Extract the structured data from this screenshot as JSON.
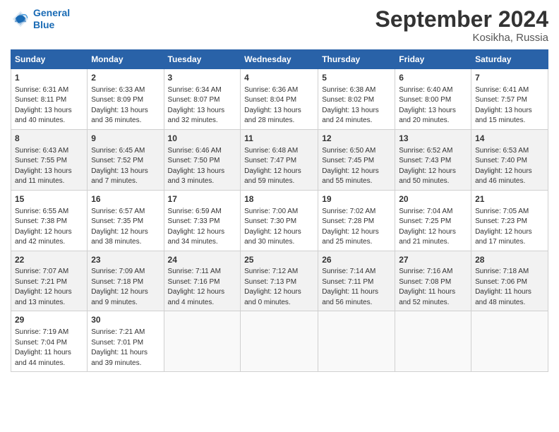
{
  "header": {
    "logo_line1": "General",
    "logo_line2": "Blue",
    "month": "September 2024",
    "location": "Kosikha, Russia"
  },
  "days_of_week": [
    "Sunday",
    "Monday",
    "Tuesday",
    "Wednesday",
    "Thursday",
    "Friday",
    "Saturday"
  ],
  "weeks": [
    [
      {
        "day": 1,
        "info": "Sunrise: 6:31 AM\nSunset: 8:11 PM\nDaylight: 13 hours\nand 40 minutes."
      },
      {
        "day": 2,
        "info": "Sunrise: 6:33 AM\nSunset: 8:09 PM\nDaylight: 13 hours\nand 36 minutes."
      },
      {
        "day": 3,
        "info": "Sunrise: 6:34 AM\nSunset: 8:07 PM\nDaylight: 13 hours\nand 32 minutes."
      },
      {
        "day": 4,
        "info": "Sunrise: 6:36 AM\nSunset: 8:04 PM\nDaylight: 13 hours\nand 28 minutes."
      },
      {
        "day": 5,
        "info": "Sunrise: 6:38 AM\nSunset: 8:02 PM\nDaylight: 13 hours\nand 24 minutes."
      },
      {
        "day": 6,
        "info": "Sunrise: 6:40 AM\nSunset: 8:00 PM\nDaylight: 13 hours\nand 20 minutes."
      },
      {
        "day": 7,
        "info": "Sunrise: 6:41 AM\nSunset: 7:57 PM\nDaylight: 13 hours\nand 15 minutes."
      }
    ],
    [
      {
        "day": 8,
        "info": "Sunrise: 6:43 AM\nSunset: 7:55 PM\nDaylight: 13 hours\nand 11 minutes."
      },
      {
        "day": 9,
        "info": "Sunrise: 6:45 AM\nSunset: 7:52 PM\nDaylight: 13 hours\nand 7 minutes."
      },
      {
        "day": 10,
        "info": "Sunrise: 6:46 AM\nSunset: 7:50 PM\nDaylight: 13 hours\nand 3 minutes."
      },
      {
        "day": 11,
        "info": "Sunrise: 6:48 AM\nSunset: 7:47 PM\nDaylight: 12 hours\nand 59 minutes."
      },
      {
        "day": 12,
        "info": "Sunrise: 6:50 AM\nSunset: 7:45 PM\nDaylight: 12 hours\nand 55 minutes."
      },
      {
        "day": 13,
        "info": "Sunrise: 6:52 AM\nSunset: 7:43 PM\nDaylight: 12 hours\nand 50 minutes."
      },
      {
        "day": 14,
        "info": "Sunrise: 6:53 AM\nSunset: 7:40 PM\nDaylight: 12 hours\nand 46 minutes."
      }
    ],
    [
      {
        "day": 15,
        "info": "Sunrise: 6:55 AM\nSunset: 7:38 PM\nDaylight: 12 hours\nand 42 minutes."
      },
      {
        "day": 16,
        "info": "Sunrise: 6:57 AM\nSunset: 7:35 PM\nDaylight: 12 hours\nand 38 minutes."
      },
      {
        "day": 17,
        "info": "Sunrise: 6:59 AM\nSunset: 7:33 PM\nDaylight: 12 hours\nand 34 minutes."
      },
      {
        "day": 18,
        "info": "Sunrise: 7:00 AM\nSunset: 7:30 PM\nDaylight: 12 hours\nand 30 minutes."
      },
      {
        "day": 19,
        "info": "Sunrise: 7:02 AM\nSunset: 7:28 PM\nDaylight: 12 hours\nand 25 minutes."
      },
      {
        "day": 20,
        "info": "Sunrise: 7:04 AM\nSunset: 7:25 PM\nDaylight: 12 hours\nand 21 minutes."
      },
      {
        "day": 21,
        "info": "Sunrise: 7:05 AM\nSunset: 7:23 PM\nDaylight: 12 hours\nand 17 minutes."
      }
    ],
    [
      {
        "day": 22,
        "info": "Sunrise: 7:07 AM\nSunset: 7:21 PM\nDaylight: 12 hours\nand 13 minutes."
      },
      {
        "day": 23,
        "info": "Sunrise: 7:09 AM\nSunset: 7:18 PM\nDaylight: 12 hours\nand 9 minutes."
      },
      {
        "day": 24,
        "info": "Sunrise: 7:11 AM\nSunset: 7:16 PM\nDaylight: 12 hours\nand 4 minutes."
      },
      {
        "day": 25,
        "info": "Sunrise: 7:12 AM\nSunset: 7:13 PM\nDaylight: 12 hours\nand 0 minutes."
      },
      {
        "day": 26,
        "info": "Sunrise: 7:14 AM\nSunset: 7:11 PM\nDaylight: 11 hours\nand 56 minutes."
      },
      {
        "day": 27,
        "info": "Sunrise: 7:16 AM\nSunset: 7:08 PM\nDaylight: 11 hours\nand 52 minutes."
      },
      {
        "day": 28,
        "info": "Sunrise: 7:18 AM\nSunset: 7:06 PM\nDaylight: 11 hours\nand 48 minutes."
      }
    ],
    [
      {
        "day": 29,
        "info": "Sunrise: 7:19 AM\nSunset: 7:04 PM\nDaylight: 11 hours\nand 44 minutes."
      },
      {
        "day": 30,
        "info": "Sunrise: 7:21 AM\nSunset: 7:01 PM\nDaylight: 11 hours\nand 39 minutes."
      },
      null,
      null,
      null,
      null,
      null
    ]
  ]
}
